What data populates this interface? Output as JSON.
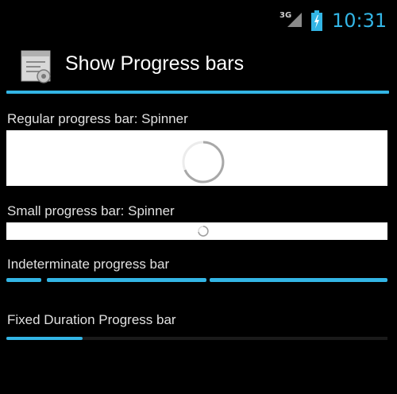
{
  "status_bar": {
    "network": "3G",
    "time": "10:31",
    "accent_color": "#33b5e5"
  },
  "action_bar": {
    "title": "Show Progress bars",
    "icon": "app-settings-icon"
  },
  "sections": {
    "regular": {
      "label": "Regular progress bar: Spinner"
    },
    "small": {
      "label": "Small progress bar: Spinner"
    },
    "indeterminate": {
      "label": "Indeterminate progress bar"
    },
    "fixed": {
      "label": "Fixed Duration Progress bar",
      "progress": 0.2
    }
  }
}
